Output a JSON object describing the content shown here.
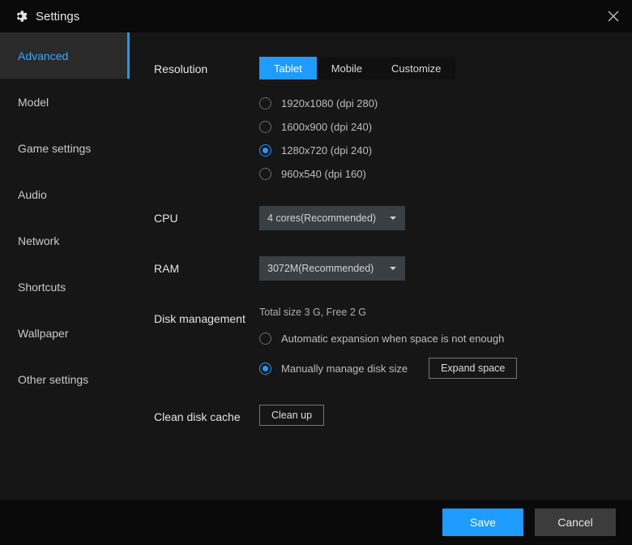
{
  "header": {
    "title": "Settings"
  },
  "sidebar": {
    "items": [
      {
        "label": "Advanced",
        "active": true
      },
      {
        "label": "Model"
      },
      {
        "label": "Game settings"
      },
      {
        "label": "Audio"
      },
      {
        "label": "Network"
      },
      {
        "label": "Shortcuts"
      },
      {
        "label": "Wallpaper"
      },
      {
        "label": "Other settings"
      }
    ]
  },
  "resolution": {
    "label": "Resolution",
    "tabs": [
      {
        "label": "Tablet",
        "active": true
      },
      {
        "label": "Mobile"
      },
      {
        "label": "Customize"
      }
    ],
    "options": [
      {
        "label": "1920x1080  (dpi 280)",
        "checked": false
      },
      {
        "label": "1600x900  (dpi 240)",
        "checked": false
      },
      {
        "label": "1280x720  (dpi 240)",
        "checked": true
      },
      {
        "label": "960x540  (dpi 160)",
        "checked": false
      }
    ]
  },
  "cpu": {
    "label": "CPU",
    "value": "4 cores(Recommended)"
  },
  "ram": {
    "label": "RAM",
    "value": "3072M(Recommended)"
  },
  "disk": {
    "label": "Disk management",
    "info": "Total size 3 G,  Free 2 G",
    "option_auto": "Automatic expansion when space is not enough",
    "option_manual": "Manually manage disk size",
    "expand_label": "Expand space",
    "selected": "manual"
  },
  "clean": {
    "label": "Clean disk cache",
    "button": "Clean up"
  },
  "footer": {
    "save": "Save",
    "cancel": "Cancel"
  }
}
